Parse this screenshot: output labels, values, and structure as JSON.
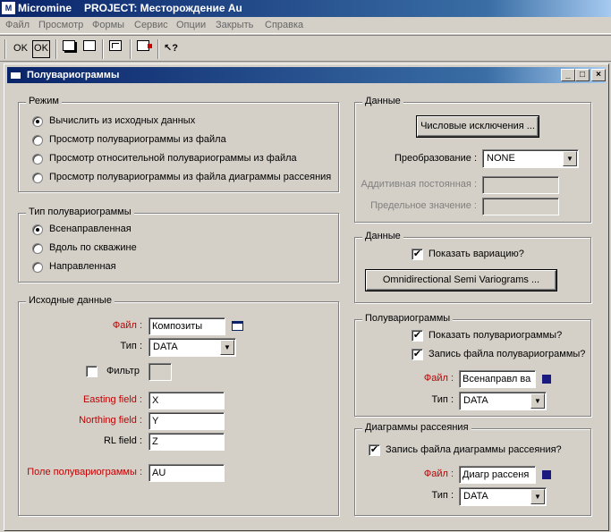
{
  "app": {
    "logo": "M",
    "name": "Micromine",
    "project": "PROJECT: Месторождение Au"
  },
  "menu": [
    "Файл",
    "Просмотр",
    "Формы",
    "Сервис",
    "Опции",
    "Закрыть",
    "Справка"
  ],
  "toolbar": {
    "ok_label": "OK",
    "ok_default_label": "OK"
  },
  "window": {
    "title": "Полувариограммы",
    "minimize": "_",
    "maximize": "□",
    "close": "×"
  },
  "mode": {
    "legend": "Режим",
    "options": [
      "Вычислить из исходных данных",
      "Просмотр полувариограммы из файла",
      "Просмотр относительной полувариограммы из файла",
      "Просмотр полувариограммы из файла диаграммы рассеяния"
    ],
    "selected": 0
  },
  "variogram_type": {
    "legend": "Тип полувариограммы",
    "options": [
      "Всенаправленная",
      "Вдоль по скважине",
      "Направленная"
    ],
    "selected": 0
  },
  "input": {
    "legend": "Исходные данные",
    "file_label": "Файл :",
    "file_value": "Композиты",
    "type_label": "Тип :",
    "type_value": "DATA",
    "filter_label": "Фильтр",
    "filter_checked": false,
    "easting_label": "Easting field :",
    "easting_value": "X",
    "northing_label": "Northing field :",
    "northing_value": "Y",
    "rl_label": "RL field :",
    "rl_value": "Z",
    "field_label": "Поле полувариограммы :",
    "field_value": "AU"
  },
  "data": {
    "legend": "Данные",
    "exclusions_button": "Числовые исключения ...",
    "transform_label": "Преобразование :",
    "transform_value": "NONE",
    "additive_label": "Аддитивная постоянная :",
    "limit_label": "Предельное значение :"
  },
  "data2": {
    "legend": "Данные",
    "show_variance_label": "Показать вариацию?",
    "show_variance_checked": true,
    "omni_button": "Omnidirectional Semi Variograms ..."
  },
  "variograms": {
    "legend": "Полувариограммы",
    "show_label": "Показать полувариограммы?",
    "show_checked": true,
    "write_label": "Запись файла полувариограммы?",
    "write_checked": true,
    "file_label": "Файл :",
    "file_value": "Всенаправл ва",
    "type_label": "Тип :",
    "type_value": "DATA"
  },
  "scatter": {
    "legend": "Диаграммы рассеяния",
    "write_label": "Запись файла диаграммы рассеяния?",
    "write_checked": true,
    "file_label": "Файл :",
    "file_value": "Диагр рассеня",
    "type_label": "Тип :",
    "type_value": "DATA"
  },
  "check_mark": "✔",
  "dropdown_arrow": "▼"
}
